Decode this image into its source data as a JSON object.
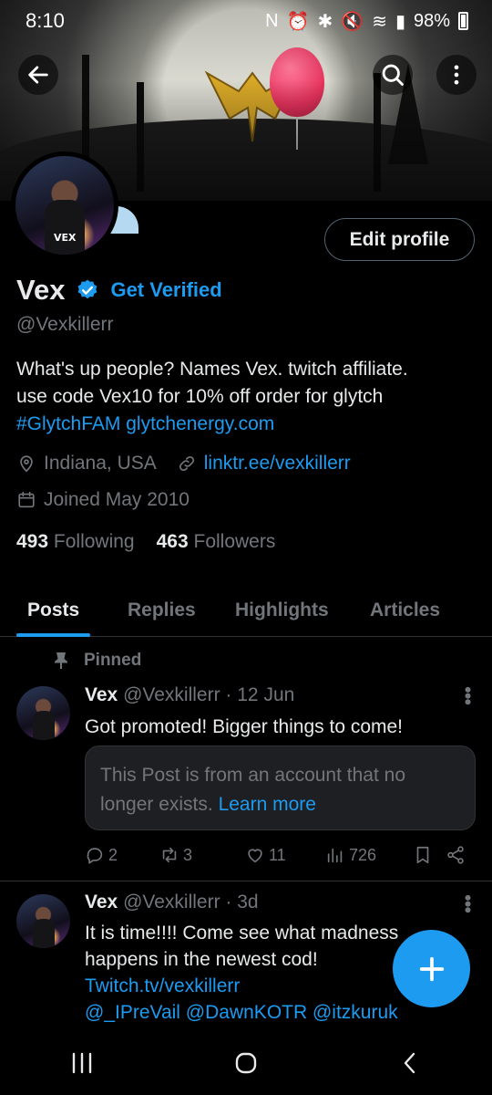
{
  "status_bar": {
    "time": "8:10",
    "battery": "98%"
  },
  "profile": {
    "name": "Vex",
    "get_verified": "Get Verified",
    "handle": "@Vexkillerr",
    "edit_label": "Edit profile",
    "bio_line1": "What's up people?  Names Vex. twitch affiliate.",
    "bio_line2": "use code Vex10 for 10% off order for glytch",
    "bio_hashtag": "#GlytchFAM",
    "bio_link": "glytchenergy.com",
    "location": "Indiana, USA",
    "website": "linktr.ee/vexkillerr",
    "joined": "Joined May 2010",
    "following_count": "493",
    "following_label": "Following",
    "followers_count": "463",
    "followers_label": "Followers"
  },
  "tabs": [
    "Posts",
    "Replies",
    "Highlights",
    "Articles"
  ],
  "pinned_label": "Pinned",
  "posts": [
    {
      "author": "Vex",
      "handle": "@Vexkillerr",
      "time": "· 12 Jun",
      "text": "Got promoted! Bigger things to come!",
      "quote_text": "This Post is from an account that no longer exists.",
      "quote_link": "Learn more",
      "replies": "2",
      "reposts": "3",
      "likes": "11",
      "views": "726"
    },
    {
      "author": "Vex",
      "handle": "@Vexkillerr",
      "time": "· 3d",
      "line1": "It is time!!!! Come see what madness",
      "line2": "happens in the newest cod!",
      "link": "Twitch.tv/vexkillerr",
      "mentions": "@_IPreVail @DawnKOTR @itzkuruk"
    }
  ],
  "colors": {
    "accent": "#1d9bf0",
    "background": "#000000",
    "muted": "#71767b",
    "text": "#e7e9ea"
  },
  "icons": [
    "back-arrow-icon",
    "search-icon",
    "more-vertical-icon",
    "verified-badge-icon",
    "location-pin-icon",
    "link-icon",
    "calendar-icon",
    "pin-icon",
    "reply-icon",
    "repost-icon",
    "like-icon",
    "views-icon",
    "bookmark-icon",
    "share-icon",
    "plus-icon"
  ]
}
